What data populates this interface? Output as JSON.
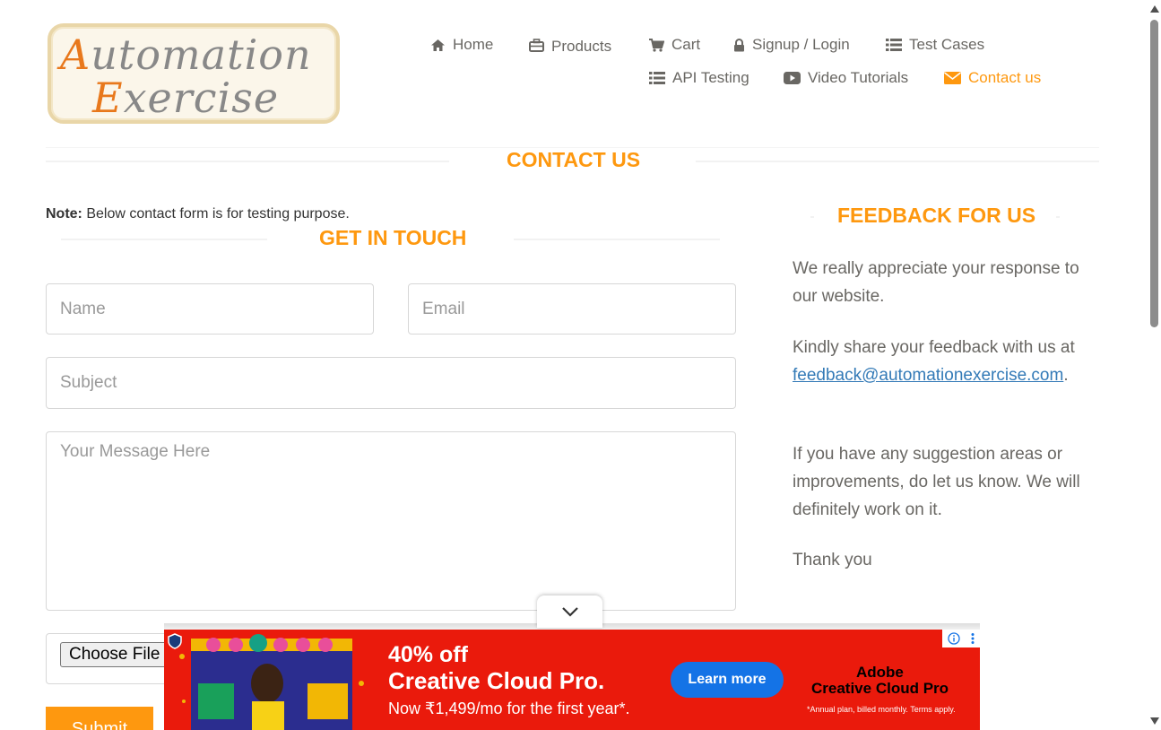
{
  "logo": {
    "line1_cap": "A",
    "line1_rest": "utomation",
    "line2_cap": "E",
    "line2_rest": "xercise"
  },
  "nav": {
    "home": "Home",
    "products": "Products",
    "cart": "Cart",
    "signup_login": "Signup / Login",
    "test_cases": "Test Cases",
    "api_testing": "API Testing",
    "video_tutorials": "Video Tutorials",
    "contact_us": "Contact us"
  },
  "page": {
    "title": "CONTACT US",
    "note_label": "Note:",
    "note_text": " Below contact form is for testing purpose."
  },
  "form": {
    "heading": "GET IN TOUCH",
    "name_placeholder": "Name",
    "email_placeholder": "Email",
    "subject_placeholder": "Subject",
    "message_placeholder": "Your Message Here",
    "file_button": "Choose File",
    "submit_label": "Submit"
  },
  "feedback": {
    "heading": "FEEDBACK FOR US",
    "p1": "We really appreciate your response to our website.",
    "p2_prefix": "Kindly share your feedback with us at ",
    "email_link": "feedback@automationexercise.com",
    "p2_suffix": ".",
    "p3": "If you have any suggestion areas or improvements, do let us know. We will definitely work on it.",
    "p4": "Thank you"
  },
  "ad": {
    "headline1": "40% off",
    "headline2": "Creative Cloud Pro.",
    "subline": "Now ₹1,499/mo for the first year*.",
    "cta": "Learn more",
    "brand_line1": "Adobe",
    "brand_line2": "Creative Cloud Pro",
    "fine_print": "*Annual plan, billed monthly. Terms apply."
  },
  "colors": {
    "accent": "#fe980f",
    "link": "#337ab7",
    "ad_bg": "#ea1a0c",
    "ad_cta": "#1473e6"
  },
  "icons": [
    "home-icon",
    "briefcase-icon",
    "cart-icon",
    "lock-icon",
    "list-icon",
    "play-icon",
    "envelope-icon",
    "chevron-down-icon",
    "info-icon",
    "more-vert-icon",
    "shield-icon"
  ]
}
